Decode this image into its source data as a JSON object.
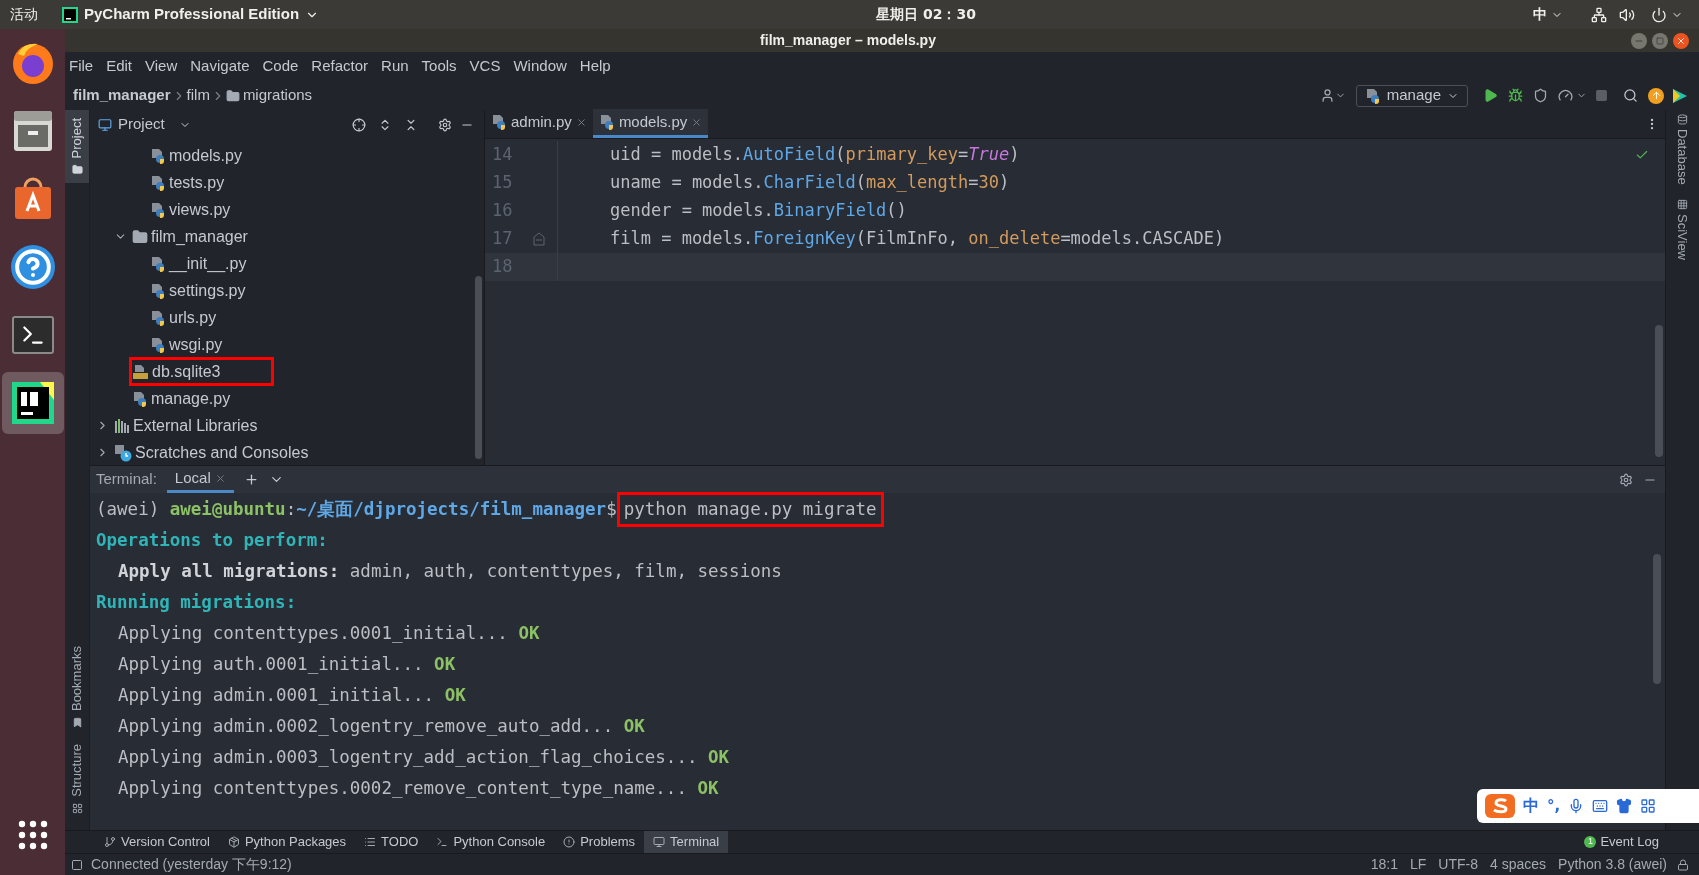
{
  "system_bar": {
    "activities": "活动",
    "app_menu": "PyCharm Professional Edition",
    "clock": "星期日 02：30",
    "input_method": "中"
  },
  "dock": {
    "apps": [
      {
        "kind": "browser",
        "selected": false
      },
      {
        "kind": "files",
        "selected": false
      },
      {
        "kind": "software",
        "selected": false
      },
      {
        "kind": "help",
        "selected": false
      },
      {
        "kind": "terminal",
        "selected": false
      },
      {
        "kind": "ide",
        "selected": true
      }
    ]
  },
  "window": {
    "title": "film_manager – models.py"
  },
  "menu": [
    {
      "label": "File"
    },
    {
      "label": "Edit"
    },
    {
      "label": "View"
    },
    {
      "label": "Navigate"
    },
    {
      "label": "Code"
    },
    {
      "label": "Refactor"
    },
    {
      "label": "Run"
    },
    {
      "label": "Tools"
    },
    {
      "label": "VCS"
    },
    {
      "label": "Window"
    },
    {
      "label": "Help"
    }
  ],
  "breadcrumbs": [
    {
      "label": "film_manager",
      "kind": "root"
    },
    {
      "label": "film",
      "kind": "plain"
    },
    {
      "label": "migrations",
      "kind": "folder"
    }
  ],
  "toolbar": {
    "run_config": "manage"
  },
  "side_tabs_left": [
    {
      "label": "Project",
      "selected": true
    },
    {
      "label": "Bookmarks",
      "selected": false
    },
    {
      "label": "Structure",
      "selected": false
    }
  ],
  "side_tabs_right": [
    {
      "label": "Database"
    },
    {
      "label": "SciView"
    }
  ],
  "project_panel": {
    "title": "Project",
    "tree": [
      {
        "kind": "group",
        "children": [
          {
            "kind": "group",
            "children": [
              {
                "label": "models.py",
                "kind": "python",
                "highlighted": false
              },
              {
                "label": "tests.py",
                "kind": "python",
                "highlighted": false
              },
              {
                "label": "views.py",
                "kind": "python",
                "highlighted": false
              }
            ]
          },
          {
            "label": "film_manager",
            "kind": "folder",
            "expanded": true,
            "highlighted": false,
            "children": [
              {
                "label": "__init__.py",
                "kind": "python",
                "highlighted": false
              },
              {
                "label": "settings.py",
                "kind": "python",
                "highlighted": false
              },
              {
                "label": "urls.py",
                "kind": "python",
                "highlighted": false
              },
              {
                "label": "wsgi.py",
                "kind": "python",
                "highlighted": false
              }
            ]
          },
          {
            "label": "db.sqlite3",
            "kind": "database",
            "highlighted": true
          },
          {
            "label": "manage.py",
            "kind": "python",
            "highlighted": false
          }
        ]
      },
      {
        "label": "External Libraries",
        "kind": "libraries",
        "expanded": false,
        "highlighted": false
      },
      {
        "label": "Scratches and Consoles",
        "kind": "scratches",
        "expanded": false,
        "highlighted": false
      }
    ]
  },
  "editor": {
    "tabs": [
      {
        "label": "admin.py",
        "selected": false
      },
      {
        "label": "models.py",
        "selected": true
      }
    ],
    "lines": [
      {
        "number": "14",
        "current": false,
        "fold_marker": false,
        "tokens": [
          {
            "text": "uid = models.",
            "kind": "plain"
          },
          {
            "text": "AutoField",
            "kind": "call"
          },
          {
            "text": "(",
            "kind": "plain"
          },
          {
            "text": "primary_key",
            "kind": "param"
          },
          {
            "text": "=",
            "kind": "plain"
          },
          {
            "text": "True",
            "kind": "keyword"
          },
          {
            "text": ")",
            "kind": "plain"
          }
        ]
      },
      {
        "number": "15",
        "current": false,
        "fold_marker": false,
        "tokens": [
          {
            "text": "uname = models.",
            "kind": "plain"
          },
          {
            "text": "CharField",
            "kind": "call"
          },
          {
            "text": "(",
            "kind": "plain"
          },
          {
            "text": "max_length",
            "kind": "param"
          },
          {
            "text": "=",
            "kind": "plain"
          },
          {
            "text": "30",
            "kind": "number"
          },
          {
            "text": ")",
            "kind": "plain"
          }
        ]
      },
      {
        "number": "16",
        "current": false,
        "fold_marker": false,
        "tokens": [
          {
            "text": "gender = models.",
            "kind": "plain"
          },
          {
            "text": "BinaryField",
            "kind": "call"
          },
          {
            "text": "()",
            "kind": "plain"
          }
        ]
      },
      {
        "number": "17",
        "current": false,
        "fold_marker": true,
        "tokens": [
          {
            "text": "film = models.",
            "kind": "plain"
          },
          {
            "text": "ForeignKey",
            "kind": "call"
          },
          {
            "text": "(FilmInFo, ",
            "kind": "plain"
          },
          {
            "text": "on_delete",
            "kind": "param"
          },
          {
            "text": "=models.CASCADE)",
            "kind": "plain"
          }
        ]
      },
      {
        "number": "18",
        "current": true,
        "fold_marker": false
      }
    ]
  },
  "terminal": {
    "label": "Terminal:",
    "tabs": [
      {
        "label": "Local",
        "selected": true
      }
    ],
    "lines": [
      {
        "kind": "prompt",
        "env": "(awei)",
        "user": "awei@ubuntu",
        "separator": ":",
        "path": "~/桌面/djprojects/film_manager",
        "symbol": "$",
        "command": "python manage.py migrate",
        "highlighted": true
      },
      {
        "kind": "heading",
        "text": "Operations to perform:"
      },
      {
        "kind": "labelled",
        "label": "Apply all migrations:",
        "text": "admin, auth, contenttypes, film, sessions"
      },
      {
        "kind": "heading",
        "text": "Running migrations:"
      },
      {
        "kind": "step",
        "text": "Applying contenttypes.0001_initial...",
        "status": "OK"
      },
      {
        "kind": "step",
        "text": "Applying auth.0001_initial...",
        "status": "OK"
      },
      {
        "kind": "step",
        "text": "Applying admin.0001_initial...",
        "status": "OK"
      },
      {
        "kind": "step",
        "text": "Applying admin.0002_logentry_remove_auto_add...",
        "status": "OK"
      },
      {
        "kind": "step",
        "text": "Applying admin.0003_logentry_add_action_flag_choices...",
        "status": "OK"
      },
      {
        "kind": "step",
        "text": "Applying contenttypes.0002_remove_content_type_name...",
        "status": "OK"
      }
    ]
  },
  "tool_windows": [
    {
      "label": "Version Control",
      "kind": "vcs",
      "selected": false
    },
    {
      "label": "Python Packages",
      "kind": "packages",
      "selected": false
    },
    {
      "label": "TODO",
      "kind": "todo",
      "selected": false
    },
    {
      "label": "Python Console",
      "kind": "console",
      "selected": false
    },
    {
      "label": "Problems",
      "kind": "problems",
      "selected": false
    },
    {
      "label": "Terminal",
      "kind": "terminal",
      "selected": true
    }
  ],
  "event_log": {
    "label": "Event Log",
    "count": "1"
  },
  "status_bar": {
    "message": "Connected (yesterday 下午9:12)",
    "items": [
      "18:1",
      "LF",
      "UTF-8",
      "4 spaces",
      "Python 3.8 (awei)"
    ]
  },
  "ime_bar": {
    "mode": "中",
    "punctuation": "°,"
  }
}
